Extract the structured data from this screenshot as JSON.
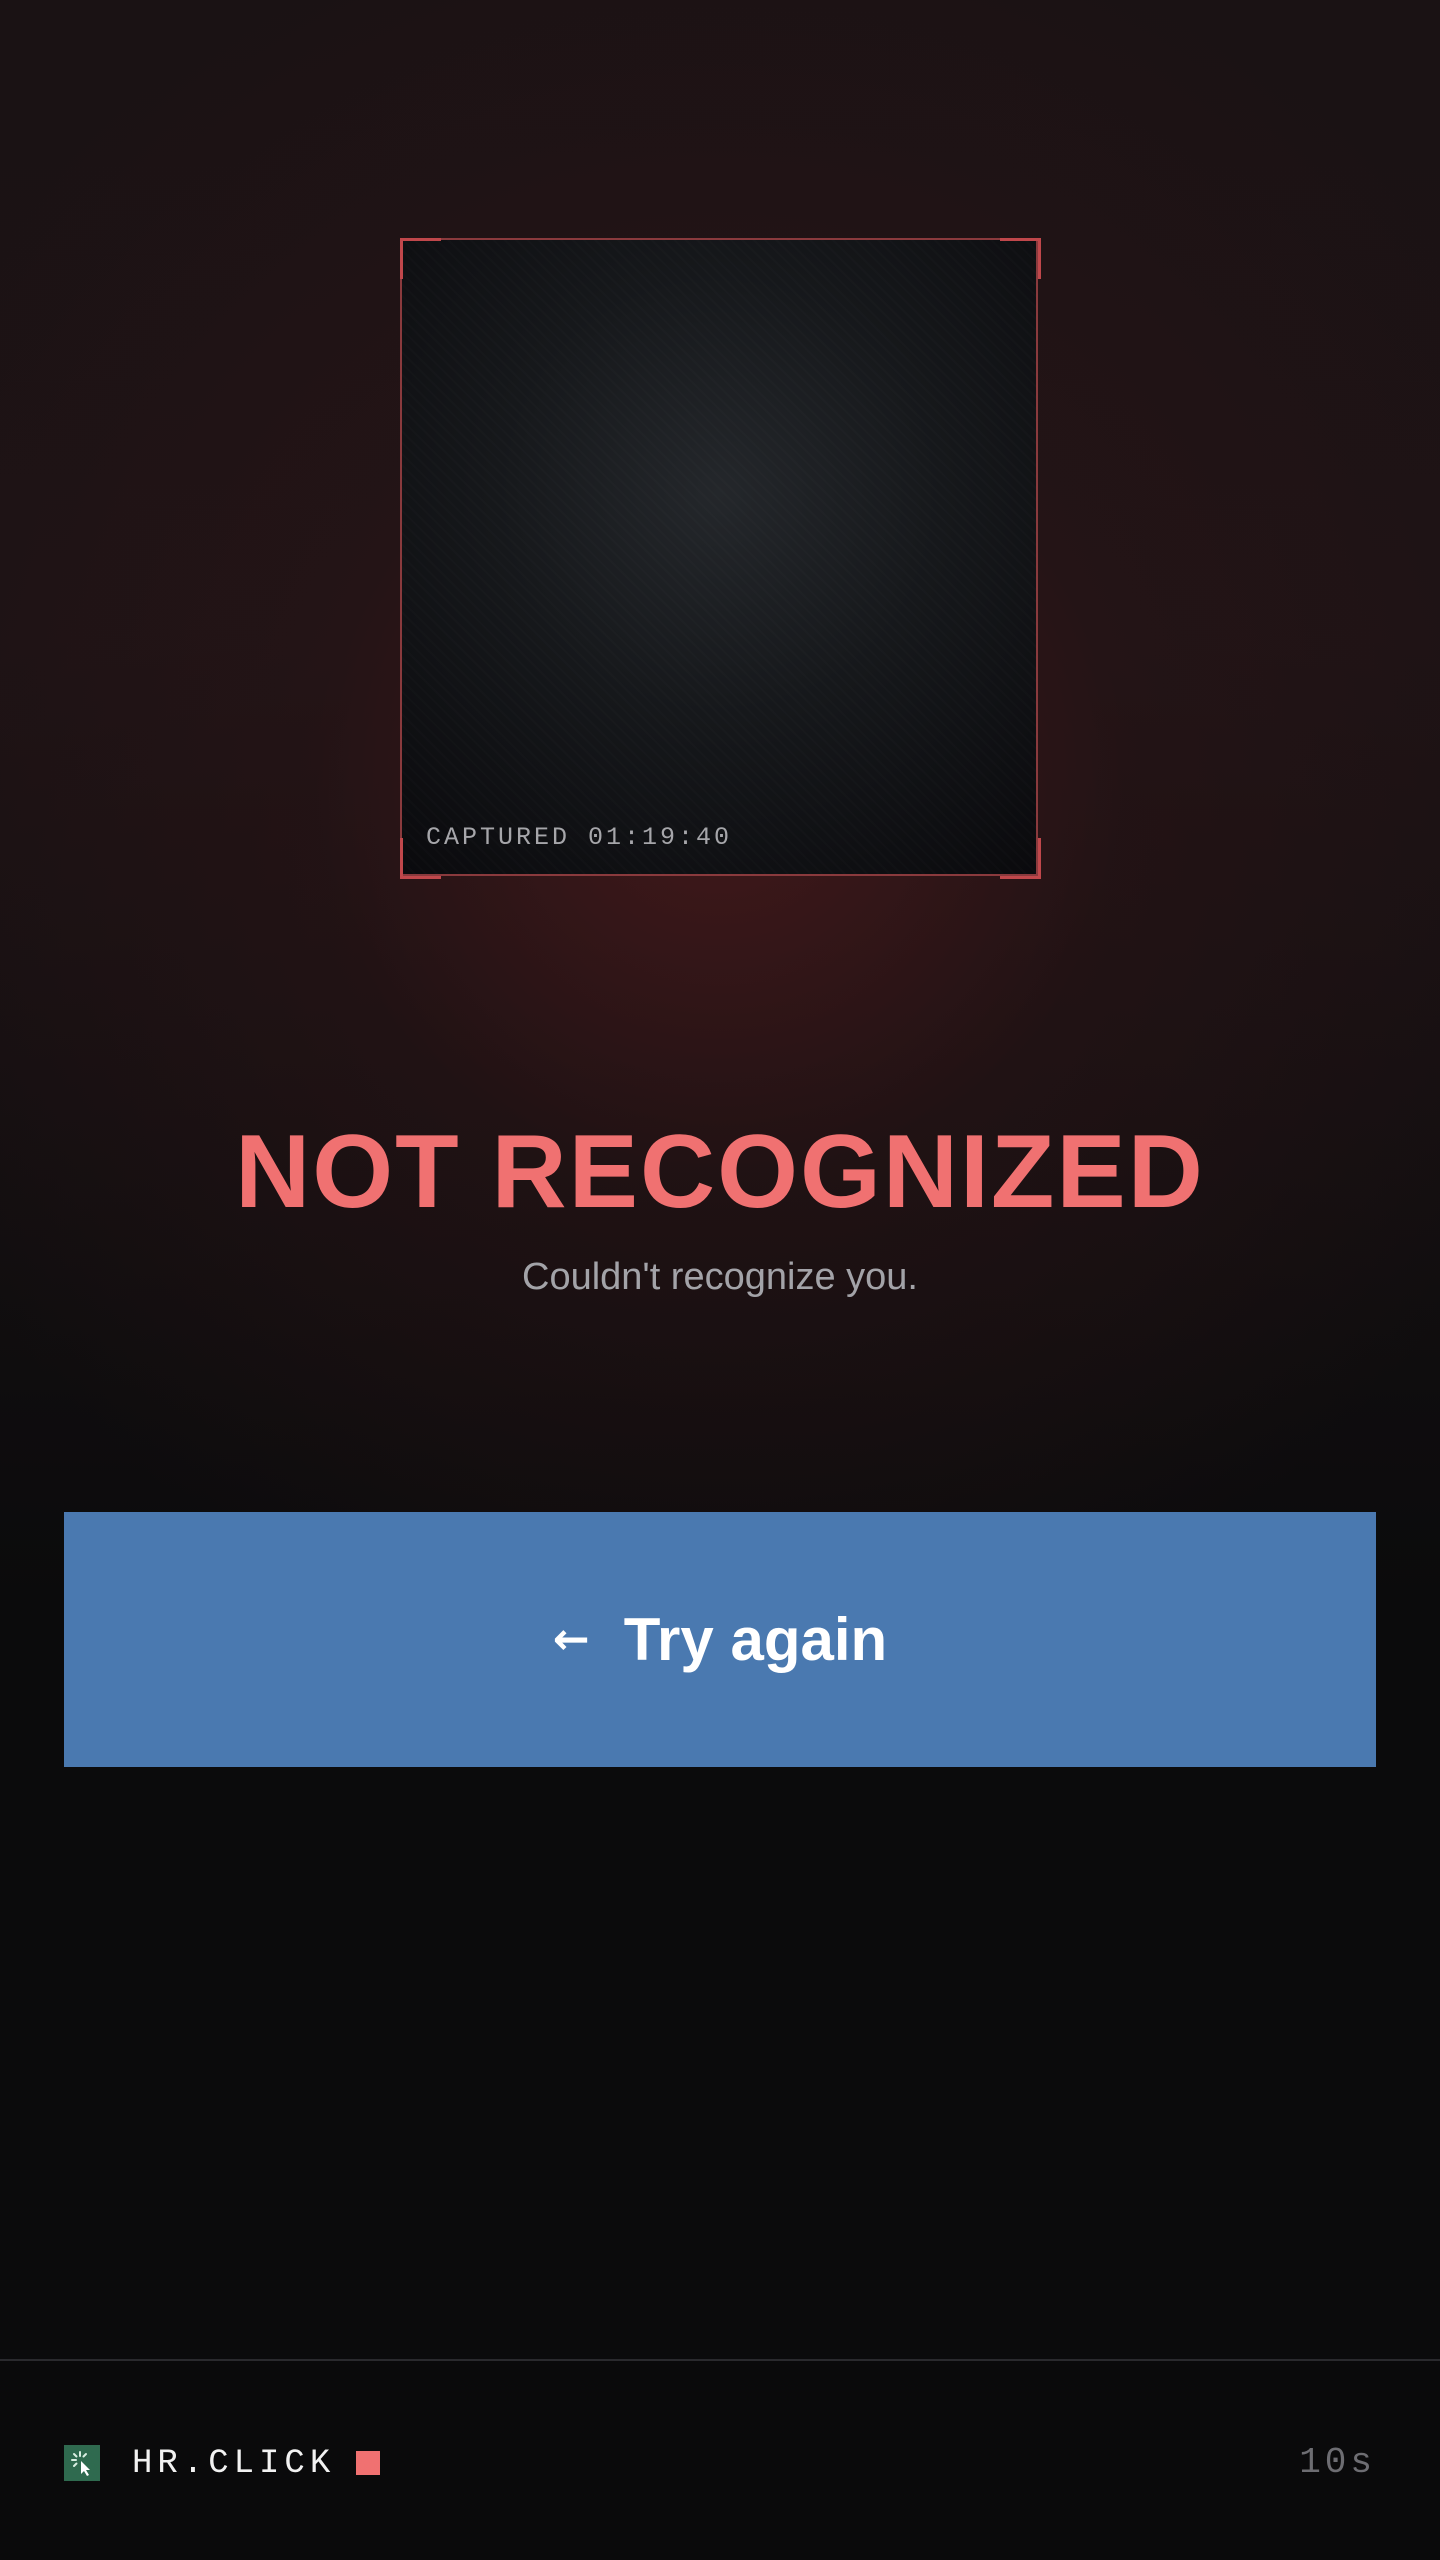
{
  "capture": {
    "label": "CAPTURED 01:19:40"
  },
  "status": {
    "title": "NOT RECOGNIZED",
    "message": "Couldn't recognize you."
  },
  "actions": {
    "try_again_icon": "←",
    "try_again_label": "Try again"
  },
  "footer": {
    "brand": "HR.CLICK",
    "logo_icon": "click-cursor-icon",
    "countdown": "10s"
  },
  "colors": {
    "error": "#f07171",
    "button": "#4a79b0",
    "logo_bg": "#2f6a4f",
    "frame_border": "#8a3a3d",
    "background": "#0b0b0c"
  }
}
